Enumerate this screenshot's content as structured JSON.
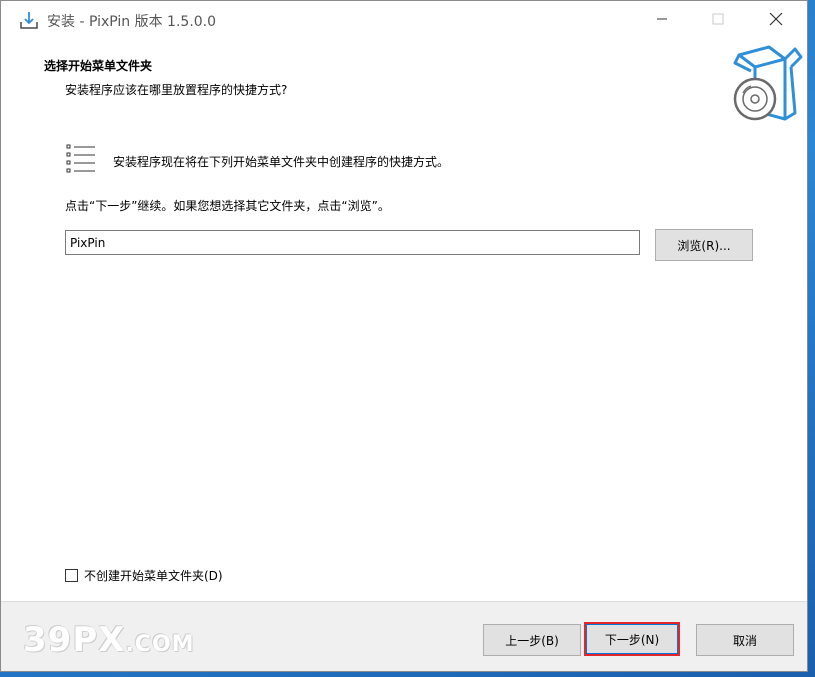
{
  "window": {
    "title": "安装 - PixPin 版本 1.5.0.0"
  },
  "header": {
    "title": "选择开始菜单文件夹",
    "subtitle": "安装程序应该在哪里放置程序的快捷方式?"
  },
  "body": {
    "info": "安装程序现在将在下列开始菜单文件夹中创建程序的快捷方式。",
    "hint": "点击“下一步”继续。如果您想选择其它文件夹，点击“浏览”。",
    "folder_value": "PixPin",
    "browse_label": "浏览(R)...",
    "no_folder_label": "不创建开始菜单文件夹(D)",
    "no_folder_checked": false
  },
  "footer": {
    "back_label": "上一步(B)",
    "next_label": "下一步(N)",
    "cancel_label": "取消",
    "watermark_main": "39PX",
    "watermark_suffix": ".COM"
  },
  "icons": {
    "app": "install-download-icon",
    "header_art": "box-disc-icon",
    "list": "list-icon",
    "minimize": "minimize-icon",
    "maximize": "maximize-icon",
    "close": "close-icon"
  },
  "colors": {
    "accent": "#0078d7",
    "highlight": "#e3262a",
    "art_blue": "#2f8fd8"
  }
}
